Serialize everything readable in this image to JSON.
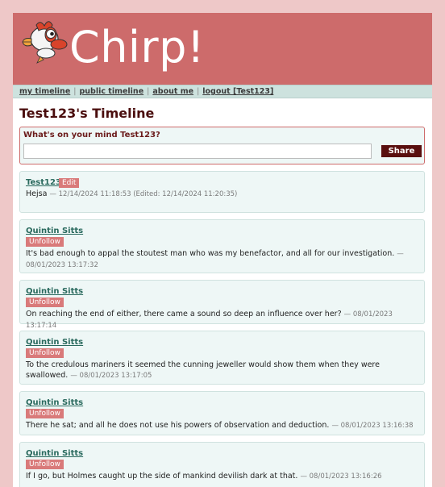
{
  "app": {
    "title": "Chirp!"
  },
  "nav": {
    "my_timeline": "my timeline",
    "public_timeline": "public timeline",
    "about_me": "about me",
    "logout": "logout [Test123]",
    "separator": "|"
  },
  "page_title": "Test123's Timeline",
  "compose": {
    "label": "What's on your mind Test123?",
    "value": "",
    "share_label": "Share"
  },
  "posts": [
    {
      "author": "Test123",
      "badge": "Edit",
      "text": "Hejsa",
      "meta": "— 12/14/2024 11:18:53 (Edited: 12/14/2024 11:20:35)"
    },
    {
      "author": "Quintin Sitts",
      "badge": "Unfollow",
      "text": "It's bad enough to appal the stoutest man who was my benefactor, and all for our investigation.",
      "meta": "— 08/01/2023 13:17:32"
    },
    {
      "author": "Quintin Sitts",
      "badge": "Unfollow",
      "text": "On reaching the end of either, there came a sound so deep an influence over her?",
      "meta": "— 08/01/2023 13:17:14"
    },
    {
      "author": "Quintin Sitts",
      "badge": "Unfollow",
      "text": "To the credulous mariners it seemed the cunning jeweller would show them when they were swallowed.",
      "meta": "— 08/01/2023 13:17:05"
    },
    {
      "author": "Quintin Sitts",
      "badge": "Unfollow",
      "text": "There he sat; and all he does not use his powers of observation and deduction.",
      "meta": "— 08/01/2023 13:16:38"
    },
    {
      "author": "Quintin Sitts",
      "badge": "Unfollow",
      "text": "If I go, but Holmes caught up the side of mankind devilish dark at that.",
      "meta": "— 08/01/2023 13:16:26"
    }
  ]
}
